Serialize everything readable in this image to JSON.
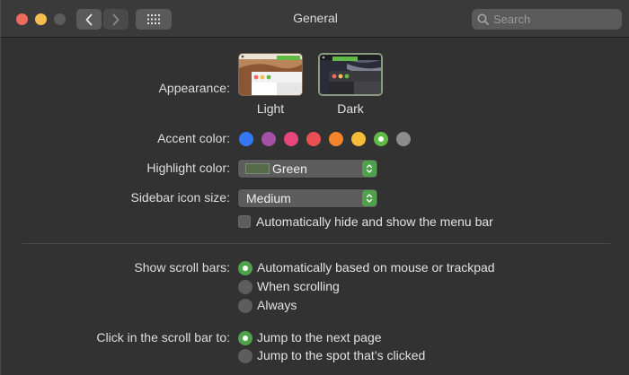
{
  "window": {
    "title": "General"
  },
  "search": {
    "placeholder": "Search"
  },
  "appearance": {
    "label": "Appearance:",
    "options": [
      {
        "label": "Light",
        "selected": false
      },
      {
        "label": "Dark",
        "selected": true
      }
    ]
  },
  "accent": {
    "label": "Accent color:",
    "colors": [
      "#3478f6",
      "#a550a7",
      "#e5467b",
      "#ea4f53",
      "#f3842b",
      "#f6bc39",
      "#62ba46",
      "#8c8c8c"
    ],
    "selected_index": 6
  },
  "highlight": {
    "label": "Highlight color:",
    "value": "Green",
    "swatch": "#556b4a"
  },
  "sidebar_icon": {
    "label": "Sidebar icon size:",
    "value": "Medium"
  },
  "menu_bar": {
    "label": "Automatically hide and show the menu bar",
    "checked": false
  },
  "scroll_bars": {
    "label": "Show scroll bars:",
    "options": [
      {
        "label": "Automatically based on mouse or trackpad",
        "selected": true
      },
      {
        "label": "When scrolling",
        "selected": false
      },
      {
        "label": "Always",
        "selected": false
      }
    ]
  },
  "click_scroll": {
    "label": "Click in the scroll bar to:",
    "options": [
      {
        "label": "Jump to the next page",
        "selected": true
      },
      {
        "label": "Jump to the spot that’s clicked",
        "selected": false
      }
    ]
  },
  "colors": {
    "accent_green": "#4fa14a",
    "window_bg": "#323232"
  },
  "icons": [
    "back-chevron-icon",
    "forward-chevron-icon",
    "grid-icon",
    "search-icon",
    "chevron-updown-icon",
    "checkbox-icon"
  ]
}
